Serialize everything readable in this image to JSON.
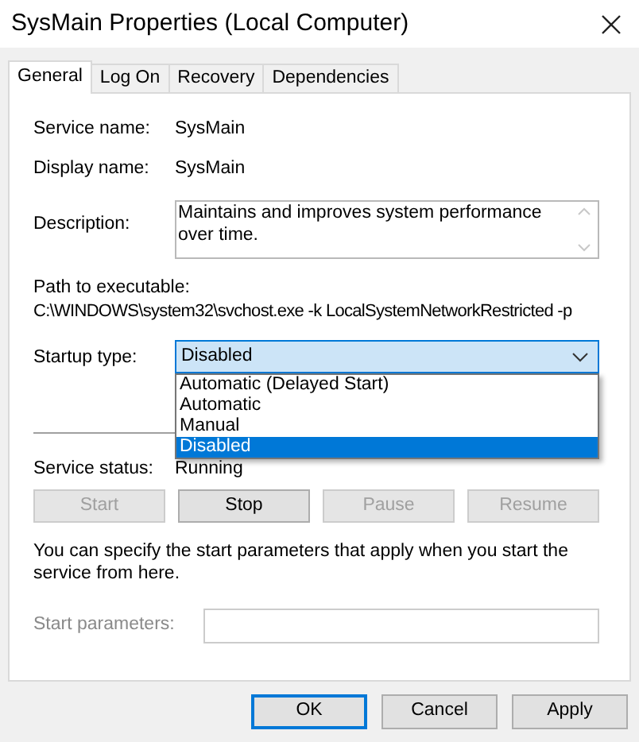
{
  "window": {
    "title": "SysMain Properties (Local Computer)"
  },
  "tabs": [
    {
      "label": "General",
      "selected": true
    },
    {
      "label": "Log On",
      "selected": false
    },
    {
      "label": "Recovery",
      "selected": false
    },
    {
      "label": "Dependencies",
      "selected": false
    }
  ],
  "fields": [
    {
      "label": "Service name:",
      "value": "SysMain"
    },
    {
      "label": "Display name:",
      "value": "SysMain"
    }
  ],
  "description": {
    "label": "Description:",
    "value": "Maintains and improves system performance over time."
  },
  "path": {
    "label": "Path to executable:",
    "value": "C:\\WINDOWS\\system32\\svchost.exe -k LocalSystemNetworkRestricted -p"
  },
  "startup_type": {
    "label": "Startup type:",
    "value": "Disabled",
    "expanded": true,
    "options": [
      {
        "label": "Automatic (Delayed Start)",
        "selected": false
      },
      {
        "label": "Automatic",
        "selected": false
      },
      {
        "label": "Manual",
        "selected": false
      },
      {
        "label": "Disabled",
        "selected": true
      }
    ]
  },
  "service_status": {
    "label": "Service status:",
    "value": "Running"
  },
  "service_buttons": [
    {
      "label": "Start",
      "disabled": true
    },
    {
      "label": "Stop",
      "disabled": false
    },
    {
      "label": "Pause",
      "disabled": true
    },
    {
      "label": "Resume",
      "disabled": true
    }
  ],
  "hint": "You can specify the start parameters that apply when you start the service from here.",
  "start_parameters": {
    "label": "Start parameters:",
    "disabled": true
  },
  "dialog_buttons": [
    {
      "label": "OK",
      "default": true
    },
    {
      "label": "Cancel",
      "default": false
    },
    {
      "label": "Apply",
      "default": false
    }
  ]
}
